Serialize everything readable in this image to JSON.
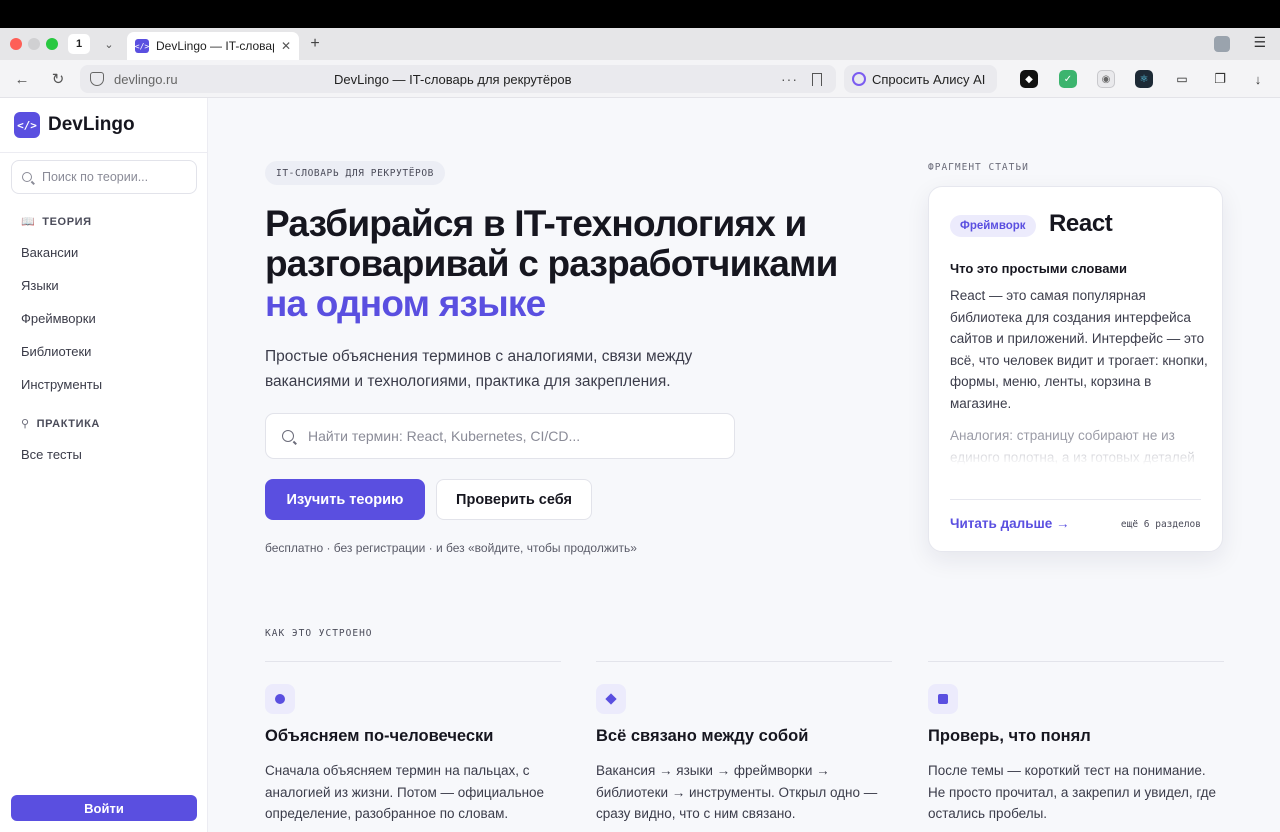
{
  "browser": {
    "tab_count": "1",
    "tab_title": "DevLingo — IT-словарь для рекрутёров",
    "url_host": "devlingo.ru",
    "url_title": "DevLingo — IT-словарь для рекрутёров",
    "alice_label": "Спросить Алису AI"
  },
  "sidebar": {
    "brand": "DevLingo",
    "search_placeholder": "Поиск по теории...",
    "section_theory": "ТЕОРИЯ",
    "theory_items": [
      "Вакансии",
      "Языки",
      "Фреймворки",
      "Библиотеки",
      "Инструменты"
    ],
    "section_practice": "ПРАКТИКА",
    "practice_items": [
      "Все тесты"
    ],
    "login_label": "Войти"
  },
  "hero": {
    "badge": "IT-СЛОВАРЬ ДЛЯ РЕКРУТЁРОВ",
    "headline_line1": "Разбирайся в IT-технологиях и",
    "headline_line2": "разговаривай с разработчиками",
    "headline_accent": "на одном языке",
    "lede": "Простые объяснения терминов с аналогиями, связи между вакансиями и технологиями, практика для закрепления.",
    "search_placeholder": "Найти термин: React, Kubernetes, CI/CD...",
    "primary_button": "Изучить теорию",
    "secondary_button": "Проверить себя",
    "note": "бесплатно · без регистрации · и без «войдите, чтобы продолжить»"
  },
  "card": {
    "label": "ФРАГМЕНТ СТАТЬИ",
    "tag": "Фреймворк",
    "title": "React",
    "subtitle": "Что это простыми словами",
    "body": "React — это самая популярная библиотека для создания интерфейса сайтов и приложений. Интерфейс — это всё, что человек видит и трогает: кнопки, формы, меню, ленты, корзина в магазине.",
    "fade_text": "Аналогия: страницу собирают не из единого полотна, а из готовых деталей",
    "read_more": "Читать дальше →",
    "more_sections": "ещё 6 разделов"
  },
  "how": {
    "label": "КАК ЭТО УСТРОЕНО",
    "features": [
      {
        "title": "Объясняем по-человечески",
        "text": "Сначала объясняем термин на пальцах, с аналогией из жизни. Потом — официальное определение, разобранное по словам."
      },
      {
        "title": "Всё связано между собой",
        "text": "Вакансия → языки → фреймворки → библиотеки → инструменты. Открыл одно — сразу видно, что с ним связано."
      },
      {
        "title": "Проверь, что понял",
        "text": "После темы — короткий тест на понимание. Не просто прочитал, а закрепил и увидел, где остались пробелы."
      }
    ]
  },
  "colors": {
    "accent": "#5a4fe0",
    "accent_soft": "#ecebfc",
    "text": "#16161f"
  }
}
